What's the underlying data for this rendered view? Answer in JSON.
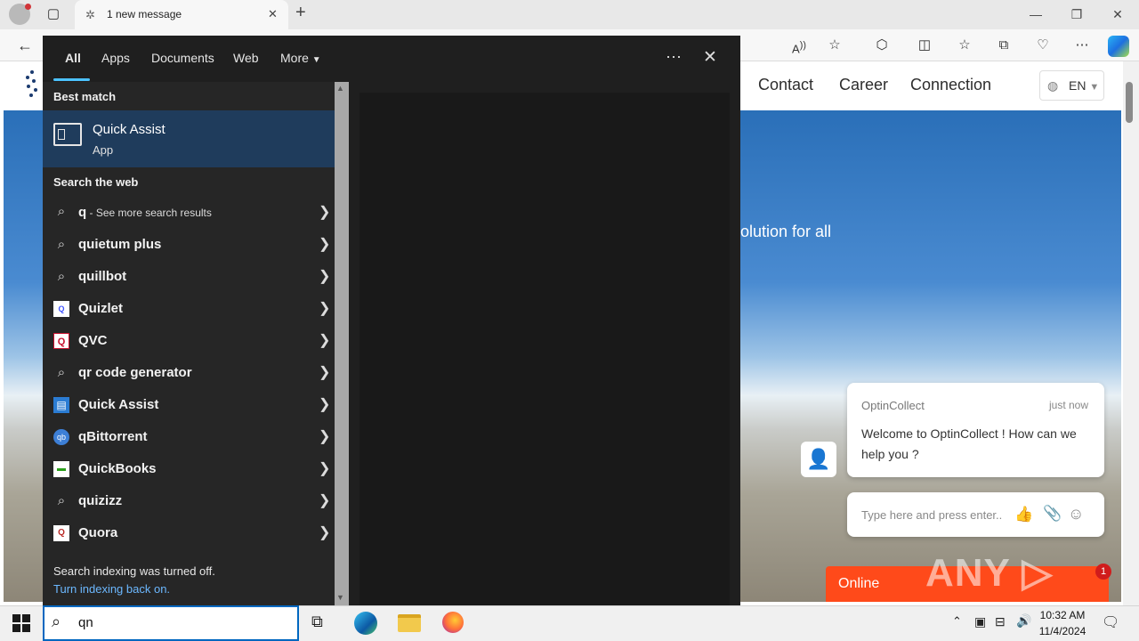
{
  "browser": {
    "tab_title": "1 new message",
    "new_tab_icon": "+",
    "close_tab_icon": "✕",
    "window_controls": [
      "—",
      "❐",
      "✕"
    ]
  },
  "site": {
    "nav_links": [
      "Contact",
      "Career",
      "Connection"
    ],
    "language": "EN",
    "hero_text": "olution for all"
  },
  "chat": {
    "sender": "OptinCollect",
    "time": "just now",
    "message": "Welcome to OptinCollect ! How can we help you ?",
    "input_placeholder": "Type here and press enter..",
    "status": "Online",
    "badge": "1"
  },
  "watermark": "ANY ▷ RUN",
  "search": {
    "tabs": [
      "All",
      "Apps",
      "Documents",
      "Web",
      "More"
    ],
    "more_icon": "⋯",
    "close_icon": "✕",
    "best_match_label": "Best match",
    "best_match": {
      "name": "Quick Assist",
      "type": "App"
    },
    "web_label": "Search the web",
    "first_web": {
      "query": "q",
      "suffix": " - See more search results"
    },
    "results": [
      {
        "label": "quietum plus",
        "icon": "search-icon"
      },
      {
        "label": "quillbot",
        "icon": "search-icon"
      },
      {
        "label": "Quizlet",
        "icon": "quizlet-icon"
      },
      {
        "label": "QVC",
        "icon": "qvc-icon"
      },
      {
        "label": "qr code generator",
        "icon": "search-icon"
      },
      {
        "label": "Quick Assist",
        "icon": "quick-assist-icon"
      },
      {
        "label": "qBittorrent",
        "icon": "qbittorrent-icon"
      },
      {
        "label": "QuickBooks",
        "icon": "quickbooks-icon"
      },
      {
        "label": "quizizz",
        "icon": "search-icon"
      },
      {
        "label": "Quora",
        "icon": "quora-icon"
      }
    ],
    "index_notice": "Search indexing was turned off.",
    "index_link": "Turn indexing back on.",
    "query_text": "qn"
  },
  "taskbar": {
    "time": "10:32 AM",
    "date": "11/4/2024"
  },
  "colors": {
    "accent": "#4cc2ff",
    "best_match_bg": "#1f3c5c",
    "online": "#ff4a1a",
    "link": "#6cb8ff"
  }
}
